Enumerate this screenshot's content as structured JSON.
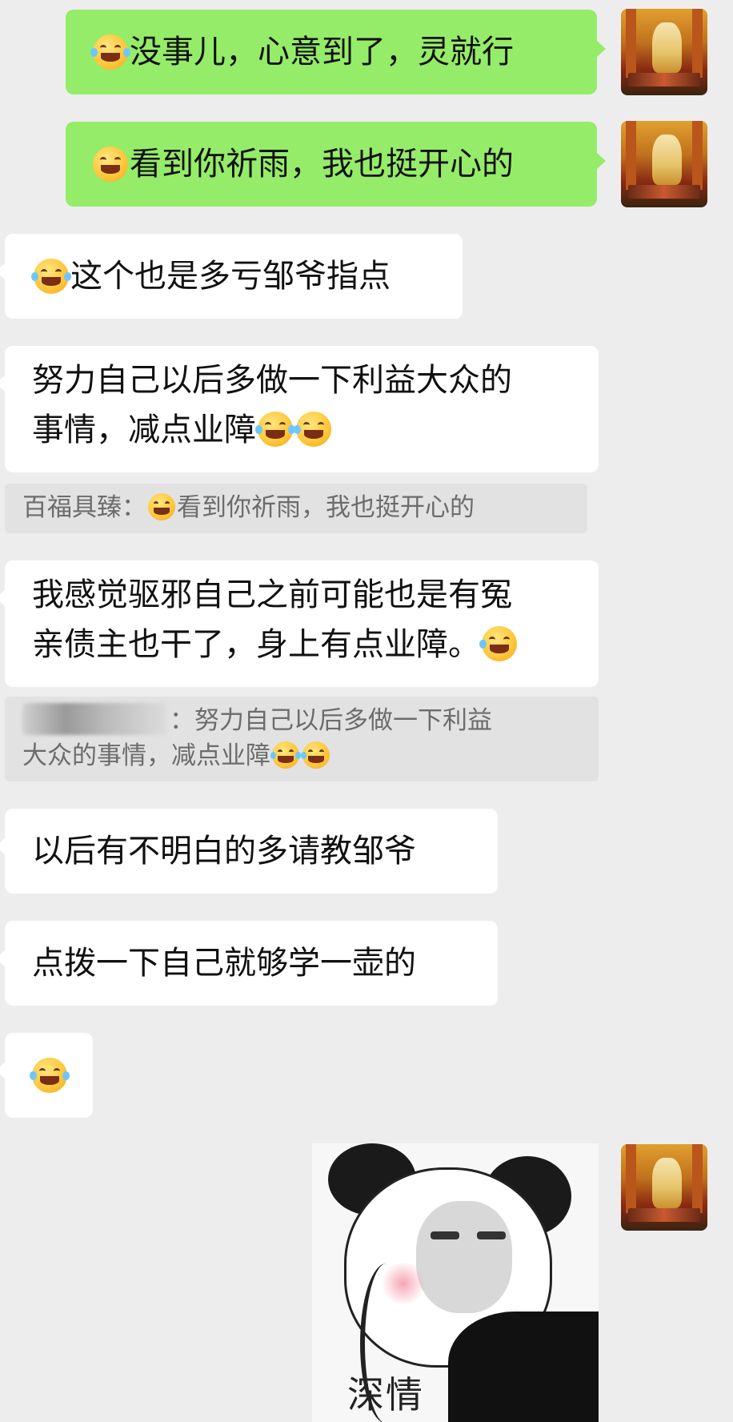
{
  "messages": {
    "out1": {
      "text": "没事儿，心意到了，灵就行"
    },
    "out2": {
      "text": "看到你祈雨，我也挺开心的"
    },
    "in1": {
      "text": "这个也是多亏邹爷指点"
    },
    "in2": {
      "line1": "努力自己以后多做一下利益大众的",
      "line2": "事情，减点业障"
    },
    "quote1": {
      "sender": "百福具臻：",
      "text": "看到你祈雨，我也挺开心的"
    },
    "in3": {
      "line1": "我感觉驱邪自己之前可能也是有冤",
      "line2": "亲债主也干了，身上有点业障。"
    },
    "quote2": {
      "sender_suffix": "：",
      "line1": "努力自己以后多做一下利益",
      "line2": "大众的事情，减点业障"
    },
    "in4": {
      "text": "以后有不明白的多请教邹爷"
    },
    "in5": {
      "text": "点拨一下自己就够学一壶的"
    },
    "sticker": {
      "caption": "深情"
    }
  },
  "icons": {
    "tears_of_joy": "face-with-tears-of-joy-emoji",
    "grin": "grinning-face-emoji",
    "crying": "loudly-crying-face-emoji"
  },
  "colors": {
    "background": "#ededed",
    "outgoing_bubble": "#95ec69",
    "incoming_bubble": "#ffffff",
    "quote_background": "#e2e2e2",
    "quote_text": "#6c6c6c"
  }
}
